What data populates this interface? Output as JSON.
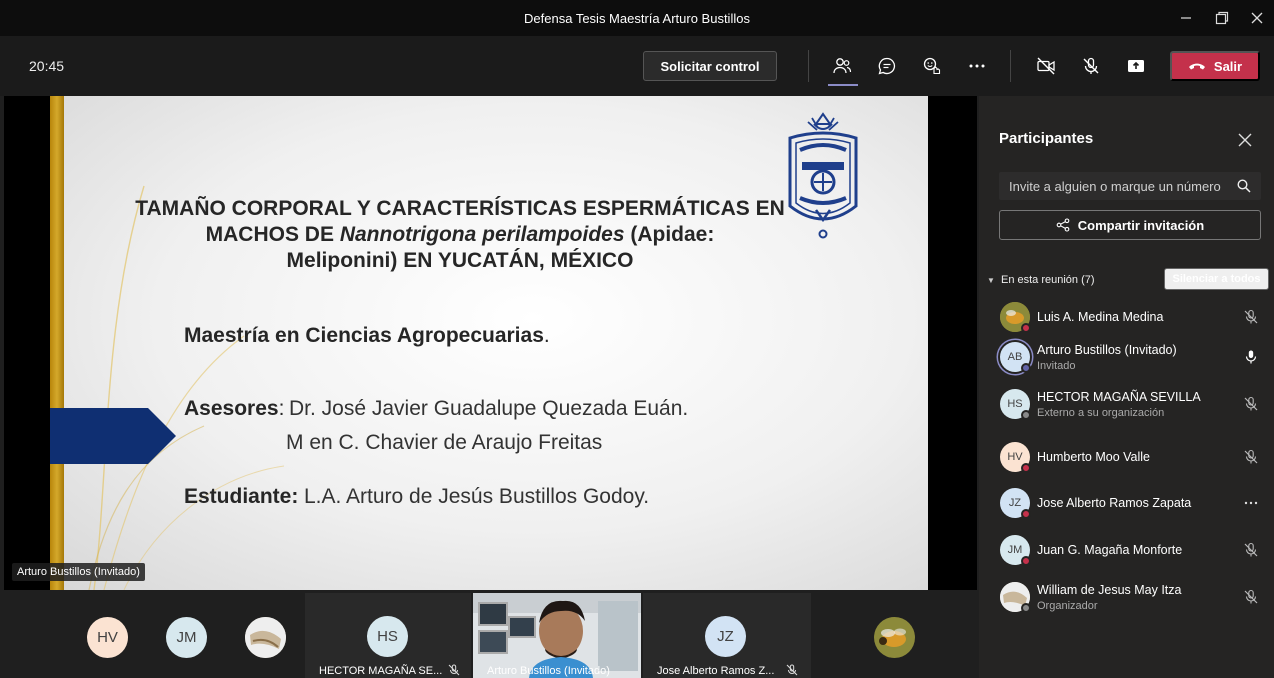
{
  "window": {
    "title": "Defensa Tesis Maestría Arturo Bustillos"
  },
  "toolbar": {
    "time": "20:45",
    "request_control_label": "Solicitar control",
    "leave_label": "Salir",
    "icons": [
      "people-icon",
      "chat-icon",
      "reactions-icon",
      "more-icon",
      "camera-off-icon",
      "mic-off-icon",
      "share-tray-icon",
      "phone-icon"
    ]
  },
  "slide": {
    "title_line1": "TAMAÑO CORPORAL Y CARACTERÍSTICAS ESPERMÁTICAS EN",
    "title_line2_prefix": "MACHOS DE ",
    "title_line2_italic": "Nannotrigona perilampoides",
    "title_line2_suffix": " (Apidae:",
    "title_line3": "Meliponini) EN YUCATÁN, MÉXICO",
    "program": "Maestría en Ciencias Agropecuarias",
    "program_dot": ".",
    "advisors_label": "Asesores",
    "advisors_colon": ": ",
    "advisor1": "Dr. José Javier Guadalupe Quezada Euán.",
    "advisor2": "M en C. Chavier de Araujo Freitas",
    "student_label": "Estudiante:",
    "student": "L.A. Arturo de Jesús Bustillos Godoy.",
    "seal_text": "UNIVERSIDAD AUTÓNOMA DE YUCATÁN"
  },
  "presenter_tag": "Arturo Bustillos (Invitado)",
  "strip": {
    "avatars": [
      {
        "initials": "HV",
        "color": "#fbe3d2"
      },
      {
        "initials": "JM",
        "color": "#d7e8ee"
      },
      {
        "initials": "",
        "color": "#d6c7b0"
      }
    ],
    "tiles": [
      {
        "initials": "HS",
        "name": "HECTOR MAGAÑA SE...",
        "color": "#d7e8ee"
      },
      {
        "initials": "",
        "name": "Arturo Bustillos (Invitado)",
        "color": "#6a7c8f"
      },
      {
        "initials": "JZ",
        "name": "Jose Alberto Ramos Z...",
        "color": "#d2e3f4"
      }
    ],
    "last_avatar_color": "#c8a14a"
  },
  "panel": {
    "title": "Participantes",
    "invite_placeholder": "Invite a alguien o marque un número",
    "share_label": "Compartir invitación",
    "section_label": "En esta reunión (7)",
    "mute_all_label": "Silenciar a todos",
    "participants": [
      {
        "initials": "",
        "name": "Luis A. Medina Medina",
        "role": "",
        "color": "#9a8a3a",
        "status": "#c4314b",
        "icon": "mic-off-icon"
      },
      {
        "initials": "AB",
        "name": "Arturo Bustillos (Invitado)",
        "role": "Invitado",
        "color": "#d2e3f4",
        "status": "#6264a7",
        "icon": "mic-icon"
      },
      {
        "initials": "HS",
        "name": "HECTOR MAGAÑA SEVILLA",
        "role": "Externo a su organización",
        "color": "#d7e8ee",
        "status": "#888888",
        "icon": "mic-off-icon"
      },
      {
        "initials": "HV",
        "name": "Humberto Moo Valle",
        "role": "",
        "color": "#fbe3d2",
        "status": "#c4314b",
        "icon": "mic-off-icon"
      },
      {
        "initials": "JZ",
        "name": "Jose Alberto Ramos Zapata",
        "role": "",
        "color": "#d2e3f4",
        "status": "#c4314b",
        "icon": "more-icon"
      },
      {
        "initials": "JM",
        "name": "Juan G. Magaña Monforte",
        "role": "",
        "color": "#d7e8ee",
        "status": "#c4314b",
        "icon": "mic-off-icon"
      },
      {
        "initials": "",
        "name": "William de Jesus May Itza",
        "role": "Organizador",
        "color": "#d6c7b0",
        "status": "#888888",
        "icon": "mic-off-icon"
      }
    ]
  }
}
